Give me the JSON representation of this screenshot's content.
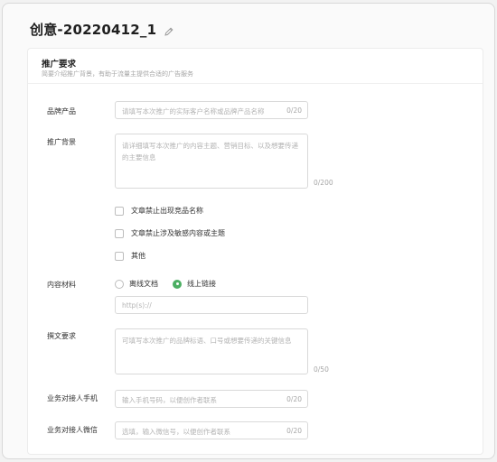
{
  "header": {
    "title": "创意-20220412_1",
    "edit_icon": "pencil-icon"
  },
  "section": {
    "title": "推广要求",
    "description": "简要介绍推广背景，有助于流量主提供合适的广告服务"
  },
  "fields": {
    "brand_product": {
      "label": "品牌产品",
      "placeholder": "请填写本次推广的实际客户名称或品牌产品名称",
      "count": "0/20"
    },
    "background": {
      "label": "推广背景",
      "placeholder": "请详细填写本次推广的内容主题、营销目标、以及想要传递的主要信息",
      "count": "0/200"
    },
    "checkboxes": [
      {
        "label": "文章禁止出现竞品名称",
        "checked": false
      },
      {
        "label": "文章禁止涉及敏感内容或主题",
        "checked": false
      },
      {
        "label": "其他",
        "checked": false
      }
    ],
    "material": {
      "label": "内容材料",
      "options": [
        "离线文档",
        "线上链接"
      ],
      "selected": "线上链接",
      "link_placeholder": "http(s)://"
    },
    "writing": {
      "label": "撰文要求",
      "placeholder": "可填写本次推广的品牌标语、口号或想要传递的关键信息",
      "count": "0/50"
    },
    "contact_phone": {
      "label": "业务对接人手机",
      "placeholder": "输入手机号码，以便创作者联系",
      "count": "0/20"
    },
    "contact_wechat": {
      "label": "业务对接人微信",
      "placeholder": "选填，输入微信号，以便创作者联系",
      "count": "0/20"
    }
  },
  "colors": {
    "accent": "#4caf63",
    "border": "#d9d9d9",
    "placeholder": "#b3b3b3"
  }
}
